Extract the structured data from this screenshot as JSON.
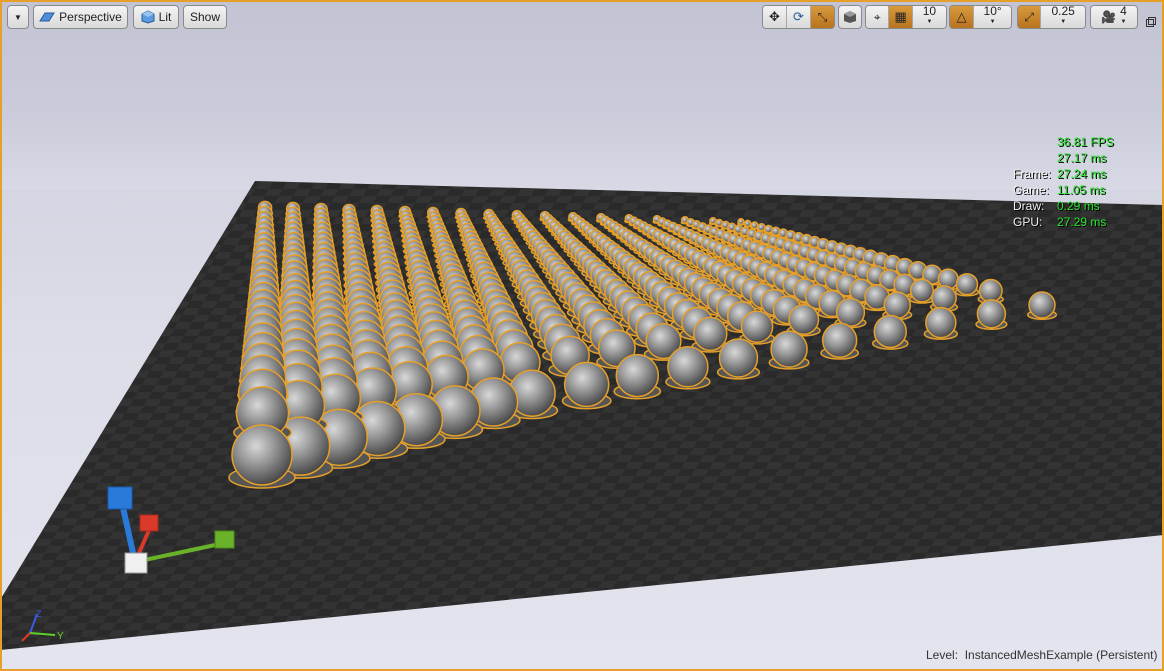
{
  "toolbar": {
    "menu_icon": "chevron-down-icon",
    "view_mode_label": "Perspective",
    "lit_label": "Lit",
    "show_label": "Show",
    "grid_snap_value": "10",
    "rotation_snap_value": "10°",
    "scale_snap_value": "0.25",
    "camera_speed_value": "4"
  },
  "stats": {
    "fps": "36.81 FPS",
    "ms": "27.17 ms",
    "rows": [
      {
        "label": "Frame:",
        "value": "27.24 ms"
      },
      {
        "label": "Game:",
        "value": "11.05 ms"
      },
      {
        "label": "Draw:",
        "value": "0.29 ms"
      },
      {
        "label": "GPU:",
        "value": "27.29 ms"
      }
    ]
  },
  "level": {
    "label": "Level:",
    "name": "InstancedMeshExample (Persistent)"
  },
  "axis": {
    "z": "Z",
    "y": "Y"
  },
  "colors": {
    "selection_outline": "#e6a02a",
    "stat_value": "#27e62a",
    "axis_x": "#d93a2a",
    "axis_y": "#6ab22a",
    "axis_z": "#2a7ad9"
  }
}
